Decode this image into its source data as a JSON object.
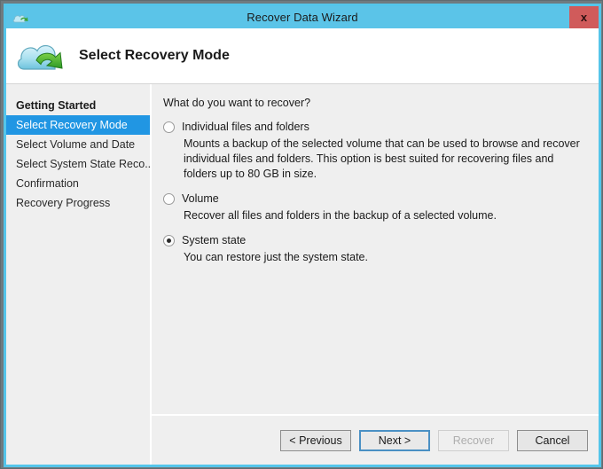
{
  "window": {
    "title": "Recover Data Wizard",
    "title_icon": "cloud-arrow-icon",
    "close_label": "x",
    "accent_title_bar": "#5bc4e8",
    "accent_close": "#d05b5b",
    "accent_selection": "#2196e3"
  },
  "header": {
    "icon": "cloud-recovery-icon",
    "title": "Select Recovery Mode"
  },
  "sidebar": {
    "items": [
      {
        "label": "Getting Started",
        "state": "completed"
      },
      {
        "label": "Select Recovery Mode",
        "state": "active"
      },
      {
        "label": "Select Volume and Date",
        "state": "pending"
      },
      {
        "label": "Select System State Reco...",
        "state": "pending"
      },
      {
        "label": "Confirmation",
        "state": "pending"
      },
      {
        "label": "Recovery Progress",
        "state": "pending"
      }
    ]
  },
  "main": {
    "question": "What do you want to recover?",
    "options": [
      {
        "label": "Individual files and folders",
        "description": "Mounts a backup of the selected volume that can be used to browse and recover individual files and folders. This option is best suited for recovering files and folders up to 80 GB in size.",
        "selected": false
      },
      {
        "label": "Volume",
        "description": "Recover all files and folders in the backup of a selected volume.",
        "selected": false
      },
      {
        "label": "System state",
        "description": "You can restore just the system state.",
        "selected": true
      }
    ]
  },
  "footer": {
    "buttons": [
      {
        "label": "< Previous",
        "state": "enabled"
      },
      {
        "label": "Next >",
        "state": "focused"
      },
      {
        "label": "Recover",
        "state": "disabled"
      },
      {
        "label": "Cancel",
        "state": "enabled"
      }
    ]
  }
}
